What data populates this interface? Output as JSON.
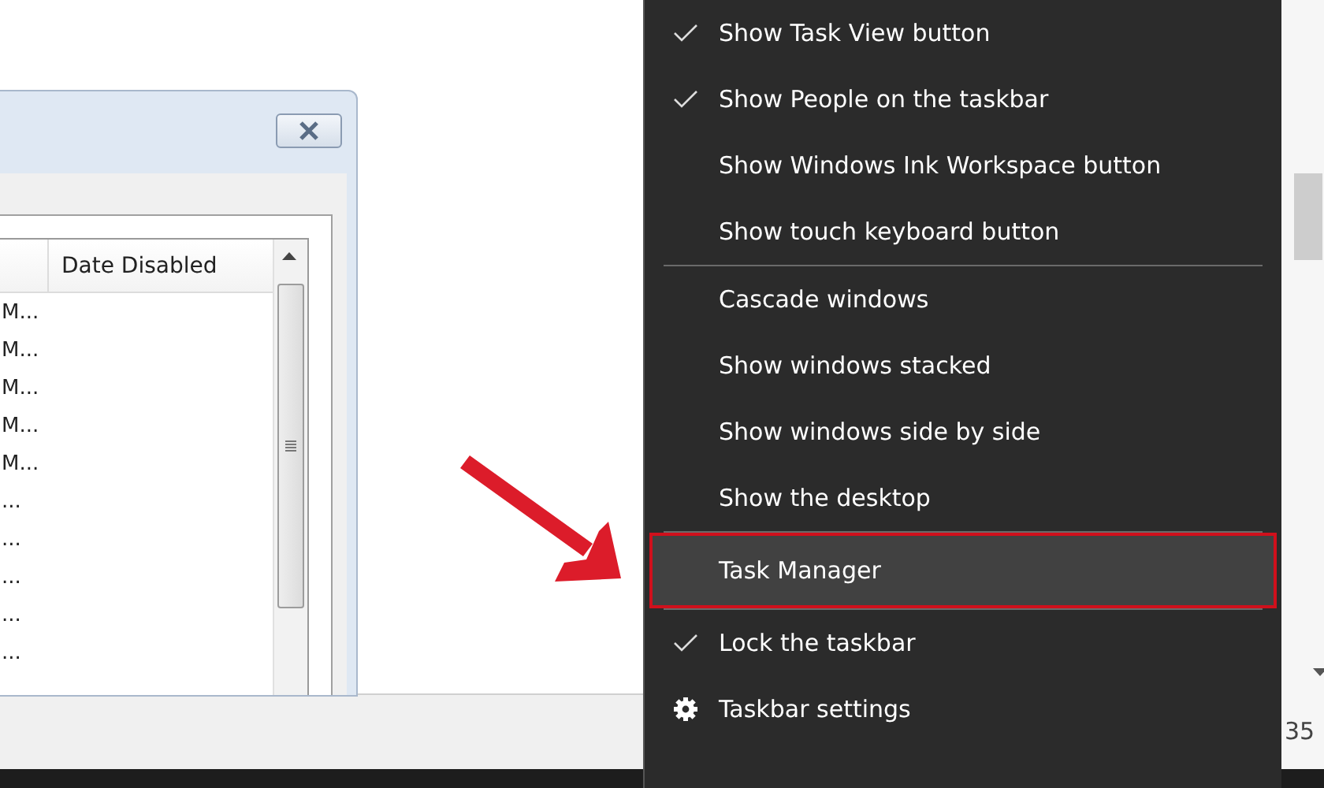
{
  "dialog": {
    "table": {
      "columns": [
        "Date Disabled"
      ],
      "rows": [
        {
          "column_1": "M..."
        },
        {
          "column_1": "M..."
        },
        {
          "column_1": "M..."
        },
        {
          "column_1": "M..."
        },
        {
          "column_1": "M..."
        },
        {
          "column_1": "..."
        },
        {
          "column_1": "..."
        },
        {
          "column_1": "..."
        },
        {
          "column_1": "..."
        },
        {
          "column_1": "..."
        }
      ]
    }
  },
  "context_menu": {
    "items": [
      {
        "kind": "check",
        "label": "Show Task View button",
        "checked": true,
        "selected": false
      },
      {
        "kind": "check",
        "label": "Show People on the taskbar",
        "checked": true,
        "selected": false
      },
      {
        "kind": "check",
        "label": "Show Windows Ink Workspace button",
        "checked": false,
        "selected": false
      },
      {
        "kind": "check",
        "label": "Show touch keyboard button",
        "checked": false,
        "selected": false
      },
      {
        "kind": "separator"
      },
      {
        "kind": "item",
        "label": "Cascade windows",
        "selected": false
      },
      {
        "kind": "item",
        "label": "Show windows stacked",
        "selected": false
      },
      {
        "kind": "item",
        "label": "Show windows side by side",
        "selected": false
      },
      {
        "kind": "item",
        "label": "Show the desktop",
        "selected": false
      },
      {
        "kind": "separator"
      },
      {
        "kind": "item",
        "label": "Task Manager",
        "selected": true
      },
      {
        "kind": "separator"
      },
      {
        "kind": "check",
        "label": "Lock the taskbar",
        "checked": true,
        "selected": false
      },
      {
        "kind": "settings",
        "label": "Taskbar settings",
        "selected": false
      }
    ]
  },
  "clock": {
    "text": "35"
  }
}
